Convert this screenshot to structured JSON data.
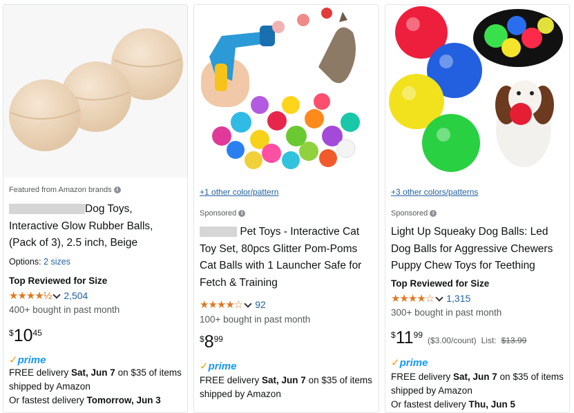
{
  "products": [
    {
      "sponsor_label": "Featured from Amazon brands",
      "title": "Dog Toys, Interactive Glow Rubber Balls, (Pack of 3), 2.5 inch, Beige",
      "options_label": "Options:",
      "options_value": "2 sizes",
      "badge": "Top Reviewed for Size",
      "stars": "★★★★½",
      "rating_count": "2,504",
      "bought": "400+ bought in past month",
      "price_whole": "10",
      "price_fraction": "45",
      "currency": "$",
      "prime": "prime",
      "delivery_prefix": "FREE delivery ",
      "delivery_date": "Sat, Jun 7",
      "delivery_suffix": " on $35 of items shipped by Amazon",
      "fastest_prefix": "Or fastest delivery ",
      "fastest_date": "Tomorrow, Jun 3"
    },
    {
      "color_link": "+1 other color/pattern",
      "sponsor_label": "Sponsored",
      "title": "Pet Toys - Interactive Cat Toy Set, 80pcs Glitter Pom-Poms Cat Balls with 1 Launcher Safe for Fetch & Training",
      "stars": "★★★★☆",
      "rating_count": "92",
      "bought": "100+ bought in past month",
      "price_whole": "8",
      "price_fraction": "99",
      "currency": "$",
      "prime": "prime",
      "delivery_prefix": "FREE delivery ",
      "delivery_date": "Sat, Jun 7",
      "delivery_suffix": " on $35 of items shipped by Amazon"
    },
    {
      "color_link": "+3 other colors/patterns",
      "sponsor_label": "Sponsored",
      "title": "Light Up Squeaky Dog Balls: Led Dog Balls for Aggressive Chewers Puppy Chew Toys for Teething",
      "badge": "Top Reviewed for Size",
      "stars": "★★★★☆",
      "rating_count": "1,315",
      "bought": "300+ bought in past month",
      "price_whole": "11",
      "price_fraction": "99",
      "currency": "$",
      "unit_price": "($3.00/count)",
      "list_label": "List:",
      "list_price": "$13.99",
      "prime": "prime",
      "delivery_prefix": "FREE delivery ",
      "delivery_date": "Sat, Jun 7",
      "delivery_suffix": " on $35 of items shipped by Amazon",
      "fastest_prefix": "Or fastest delivery ",
      "fastest_date": "Thu, Jun 5"
    }
  ],
  "colors": {
    "link": "#2162a1",
    "star": "#de7921",
    "prime": "#1399ff"
  },
  "icons": {
    "info": "info-icon",
    "chevron": "chevron-down-icon",
    "prime_check": "check-icon"
  }
}
